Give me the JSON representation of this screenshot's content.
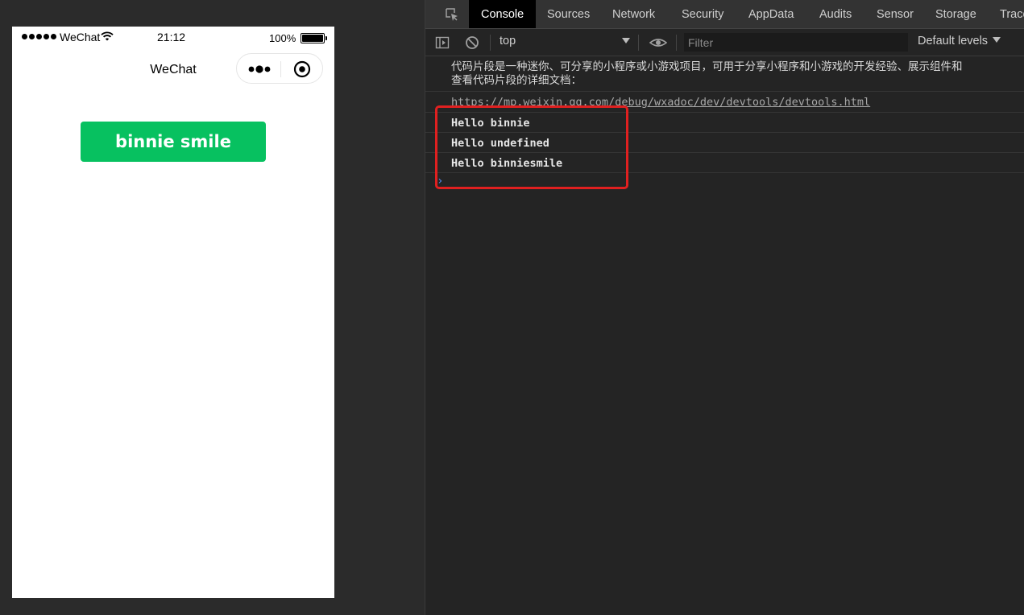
{
  "simulator": {
    "status_bar": {
      "carrier": "WeChat",
      "time": "21:12",
      "battery": "100%"
    },
    "nav": {
      "title": "WeChat"
    },
    "button": {
      "label": "binnie smile"
    }
  },
  "devtools": {
    "tabs": [
      {
        "label": "Console",
        "active": true
      },
      {
        "label": "Sources",
        "active": false
      },
      {
        "label": "Network",
        "active": false
      },
      {
        "label": "Security",
        "active": false
      },
      {
        "label": "AppData",
        "active": false
      },
      {
        "label": "Audits",
        "active": false
      },
      {
        "label": "Sensor",
        "active": false
      },
      {
        "label": "Storage",
        "active": false
      },
      {
        "label": "Trace",
        "active": false
      }
    ],
    "toolbar": {
      "context": "top",
      "filter_placeholder": "Filter",
      "filter_value": "",
      "levels": "Default levels"
    },
    "console": {
      "info_line_1": "代码片段是一种迷你、可分享的小程序或小游戏项目，可用于分享小程序和小游戏的开发经验、展示组件和",
      "info_line_2": "查看代码片段的详细文档：",
      "link": "https://mp.weixin.qq.com/debug/wxadoc/dev/devtools/devtools.html",
      "logs": [
        "Hello binnie",
        "Hello undefined",
        "Hello binniesmile"
      ],
      "prompt": "›"
    },
    "colors": {
      "highlight": "#e02020",
      "button_green": "#07c160",
      "active_tab": "#000000"
    }
  }
}
